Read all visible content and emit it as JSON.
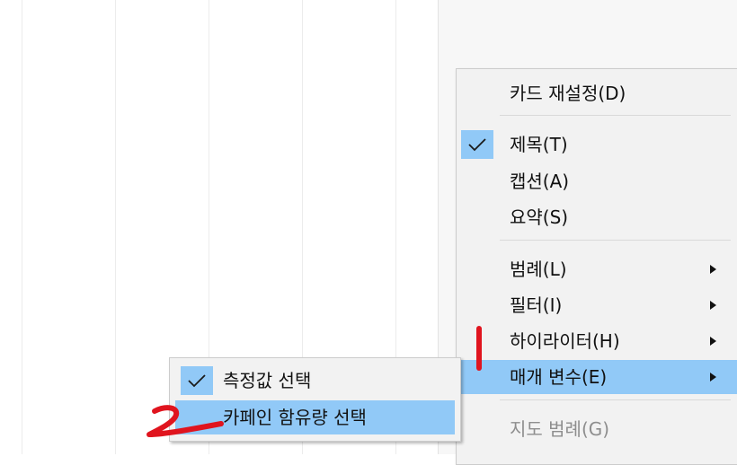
{
  "colors": {
    "highlight": "#91c9f7",
    "menu_background": "#f2f2f2",
    "annotation": "#e0141e"
  },
  "main_menu": {
    "items": [
      {
        "label": "카드 재설정(D)",
        "checked": false,
        "submenu": false,
        "disabled": false
      },
      {
        "label": "제목(T)",
        "checked": true,
        "submenu": false,
        "disabled": false
      },
      {
        "label": "캡션(A)",
        "checked": false,
        "submenu": false,
        "disabled": false
      },
      {
        "label": "요약(S)",
        "checked": false,
        "submenu": false,
        "disabled": false
      },
      {
        "label": "범례(L)",
        "checked": false,
        "submenu": true,
        "disabled": false
      },
      {
        "label": "필터(I)",
        "checked": false,
        "submenu": true,
        "disabled": false
      },
      {
        "label": "하이라이터(H)",
        "checked": false,
        "submenu": true,
        "disabled": false
      },
      {
        "label": "매개 변수(E)",
        "checked": false,
        "submenu": true,
        "disabled": false,
        "highlighted": true
      },
      {
        "label": "지도 범례(G)",
        "checked": false,
        "submenu": false,
        "disabled": true
      }
    ]
  },
  "sub_menu": {
    "items": [
      {
        "label": "측정값 선택",
        "checked": true,
        "highlighted": false
      },
      {
        "label": "카페인 함유량 선택",
        "checked": false,
        "highlighted": true
      }
    ]
  },
  "annotations": {
    "step1": "1",
    "step2": "2"
  }
}
